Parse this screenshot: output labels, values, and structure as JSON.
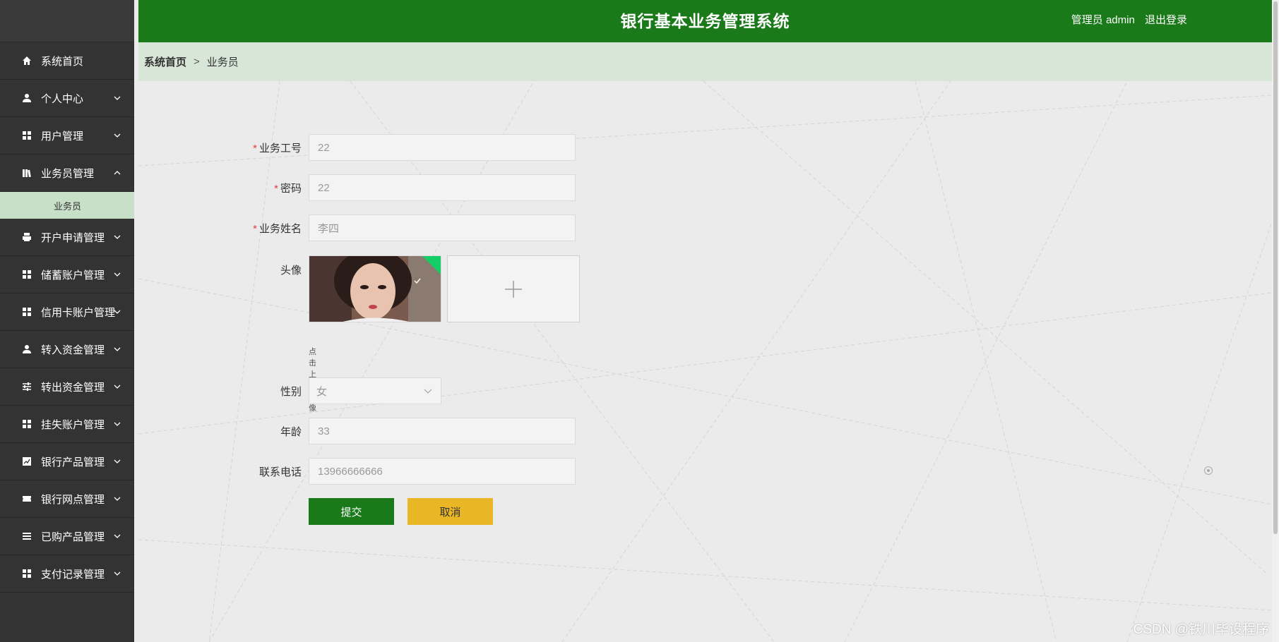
{
  "header": {
    "title": "银行基本业务管理系统",
    "user": "管理员 admin",
    "logout": "退出登录"
  },
  "breadcrumb": {
    "home": "系统首页",
    "separator": ">",
    "current": "业务员"
  },
  "sidebar": {
    "items": [
      {
        "label": "系统首页",
        "icon": "home-icon"
      },
      {
        "label": "个人中心",
        "icon": "person-icon"
      },
      {
        "label": "用户管理",
        "icon": "grid-icon"
      },
      {
        "label": "业务员管理",
        "icon": "book-icon"
      },
      {
        "label": "开户申请管理",
        "icon": "print-icon"
      },
      {
        "label": "储蓄账户管理",
        "icon": "grid-icon"
      },
      {
        "label": "信用卡账户管理",
        "icon": "grid-icon"
      },
      {
        "label": "转入资金管理",
        "icon": "person-icon"
      },
      {
        "label": "转出资金管理",
        "icon": "sliders-icon"
      },
      {
        "label": "挂失账户管理",
        "icon": "grid-icon"
      },
      {
        "label": "银行产品管理",
        "icon": "chart-icon"
      },
      {
        "label": "银行网点管理",
        "icon": "ticket-icon"
      },
      {
        "label": "已购产品管理",
        "icon": "list-icon"
      },
      {
        "label": "支付记录管理",
        "icon": "grid-icon"
      }
    ],
    "sub_item": "业务员"
  },
  "form": {
    "staff_id": {
      "label": "业务工号",
      "value": "22"
    },
    "password": {
      "label": "密码",
      "value": "22"
    },
    "name": {
      "label": "业务姓名",
      "value": "李四"
    },
    "avatar": {
      "label": "头像",
      "hint": "点击上传头像"
    },
    "gender": {
      "label": "性别",
      "value": "女"
    },
    "age": {
      "label": "年龄",
      "value": "33"
    },
    "phone": {
      "label": "联系电话",
      "value": "13966666666"
    },
    "submit": "提交",
    "cancel": "取消"
  },
  "watermark": "CSDN @铁川毕设程序",
  "colors": {
    "primary": "#1a7a1a",
    "cancel": "#e9b626",
    "sidebar": "#333333",
    "breadcrumb_bg": "#d8e6d8",
    "required": "#e04040"
  }
}
